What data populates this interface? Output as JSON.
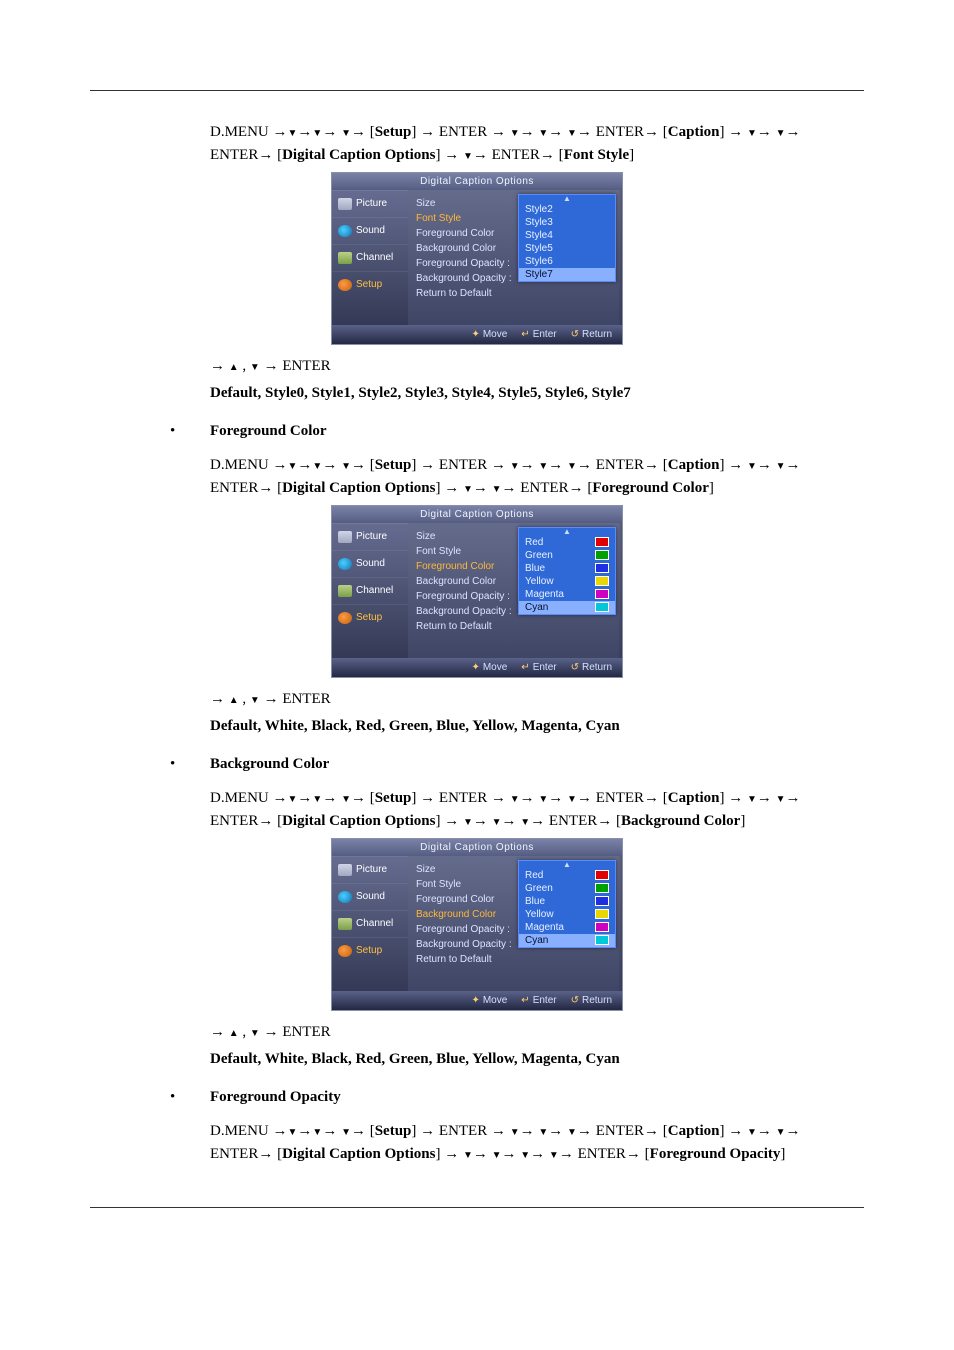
{
  "glyph": {
    "arrow": "→",
    "up": "▲",
    "down": "▼",
    "comma": " , "
  },
  "common": {
    "menu_prefix": "D.MENU ",
    "enter": "ENTER",
    "setup": "Setup",
    "caption": "Caption",
    "dco": "Digital Caption Options",
    "arrows_enter": "→  ,  → ENTER"
  },
  "osd": {
    "title": "Digital Caption Options",
    "tabs": {
      "picture": "Picture",
      "sound": "Sound",
      "channel": "Channel",
      "setup": "Setup"
    },
    "rows": [
      "Size",
      "Font Style",
      "Foreground Color",
      "Background Color",
      "Foreground Opacity",
      "Background Opacity",
      "Return to Default"
    ],
    "footer": {
      "move": "Move",
      "enter": "Enter",
      "return": "Return"
    },
    "hint_colon": " : "
  },
  "screens": {
    "font_style": {
      "path_tail": "Font Style",
      "down_steps_after_dco": 1,
      "highlight_row_index": 1,
      "options": [
        "Style2",
        "Style3",
        "Style4",
        "Style5",
        "Style6",
        "Style7"
      ],
      "selected_index": 5,
      "result": "Default, Style0, Style1, Style2, Style3, Style4, Style5, Style6, Style7"
    },
    "fg_color": {
      "heading": "Foreground Color",
      "path_tail": "Foreground Color",
      "down_steps_after_dco": 2,
      "highlight_row_index": 2,
      "options": [
        {
          "label": "Red",
          "swatch": "sw-red"
        },
        {
          "label": "Green",
          "swatch": "sw-green"
        },
        {
          "label": "Blue",
          "swatch": "sw-blue"
        },
        {
          "label": "Yellow",
          "swatch": "sw-yellow"
        },
        {
          "label": "Magenta",
          "swatch": "sw-magenta"
        },
        {
          "label": "Cyan",
          "swatch": "sw-cyan"
        }
      ],
      "selected_index": 5,
      "result": "Default, White, Black, Red, Green, Blue, Yellow, Magenta, Cyan"
    },
    "bg_color": {
      "heading": "Background Color",
      "path_tail": "Background Color",
      "down_steps_after_dco": 3,
      "highlight_row_index": 3,
      "options": [
        {
          "label": "Red",
          "swatch": "sw-red"
        },
        {
          "label": "Green",
          "swatch": "sw-green"
        },
        {
          "label": "Blue",
          "swatch": "sw-blue"
        },
        {
          "label": "Yellow",
          "swatch": "sw-yellow"
        },
        {
          "label": "Magenta",
          "swatch": "sw-magenta"
        },
        {
          "label": "Cyan",
          "swatch": "sw-cyan"
        }
      ],
      "selected_index": 5,
      "result": "Default, White, Black, Red, Green, Blue, Yellow, Magenta, Cyan"
    },
    "fg_opacity": {
      "heading": "Foreground Opacity",
      "path_tail": "Foreground Opacity",
      "down_steps_after_dco": 4
    }
  }
}
